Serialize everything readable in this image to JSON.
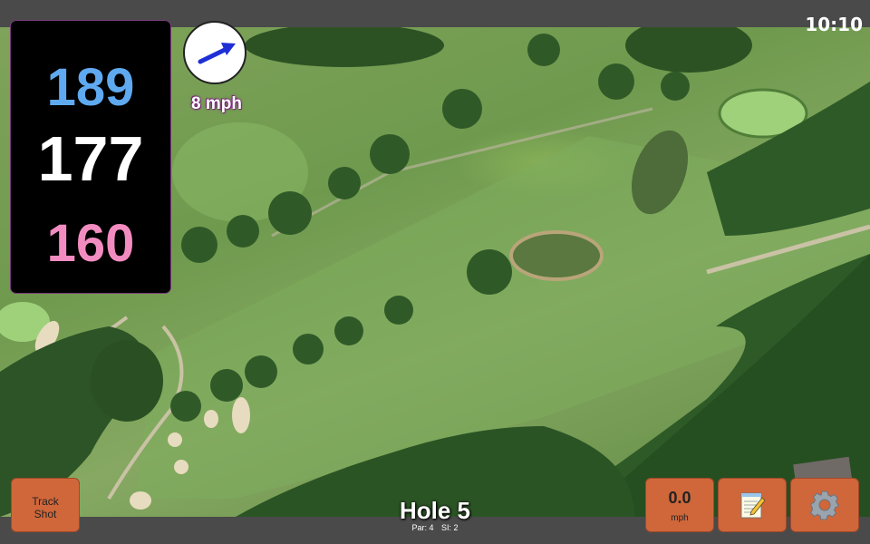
{
  "status": {
    "time": "10:10"
  },
  "yardage": {
    "back": "189",
    "middle": "177",
    "front": "160"
  },
  "wind": {
    "speed": "8 mph",
    "direction_icon": "wind-arrow-icon"
  },
  "hole": {
    "title": "Hole 5",
    "par": "Par: 4",
    "si": "SI: 2"
  },
  "buttons": {
    "track_shot_line1": "Track",
    "track_shot_line2": "Shot",
    "speed_value": "0.0",
    "speed_unit": "mph",
    "notes_icon": "notepad-icon",
    "settings_icon": "gear-icon"
  },
  "colors": {
    "back_yardage": "#5fa9f0",
    "middle_yardage": "#ffffff",
    "front_yardage": "#f28cc0",
    "button": "#d0673a",
    "wind_arrow": "#1f2fd6"
  }
}
